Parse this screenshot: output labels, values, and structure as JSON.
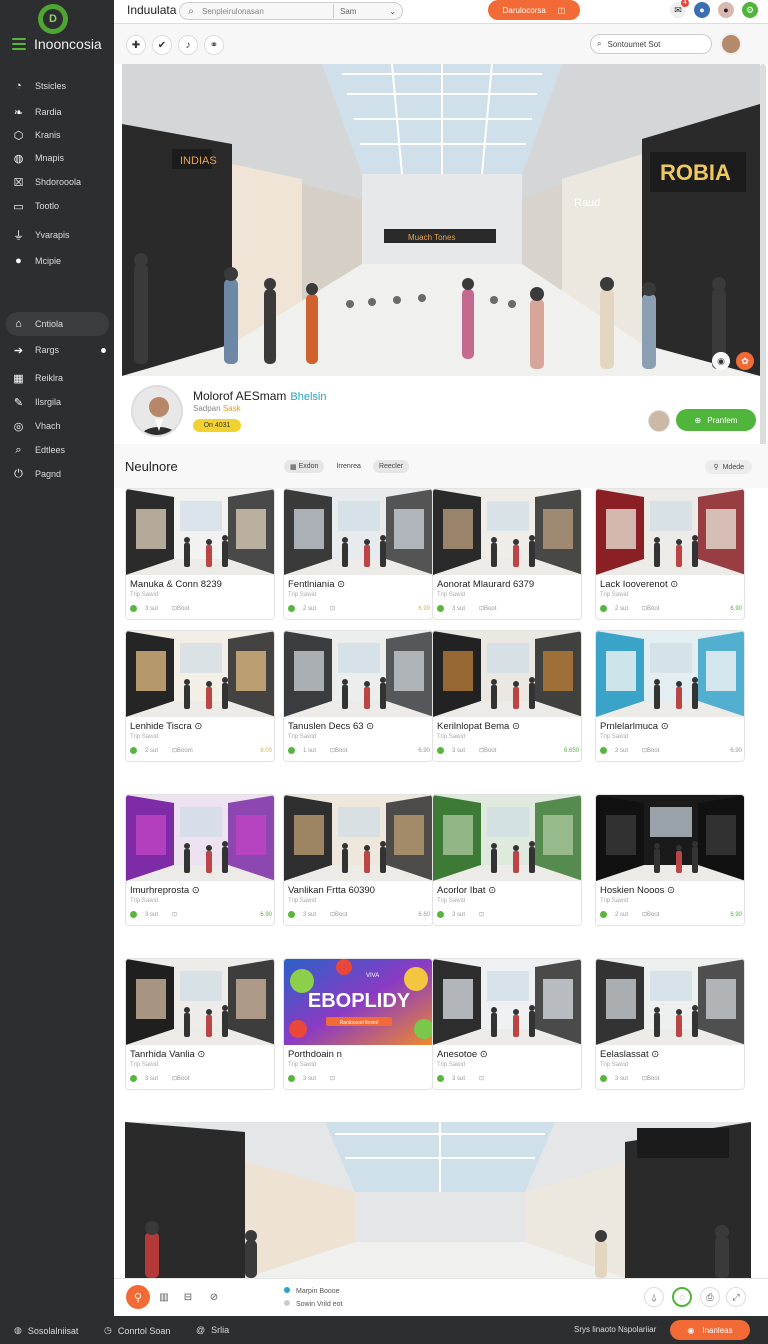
{
  "app": {
    "brand": "Inooncosia",
    "title": "Induulata"
  },
  "topbar": {
    "search_placeholder": "Senpleirulonasan",
    "select_value": "Sam",
    "cta_label": "Darulocorsa",
    "notif_count": "4"
  },
  "sidebar": {
    "items": [
      {
        "label": "Stsicles",
        "icon": "clock-icon"
      },
      {
        "label": "Rardia",
        "icon": "leaf-icon"
      },
      {
        "label": "Kranis",
        "icon": "tag-icon"
      },
      {
        "label": "Mnapis",
        "icon": "globe-icon"
      },
      {
        "label": "Shdorooola",
        "icon": "calendar-icon"
      },
      {
        "label": "Tootlo",
        "icon": "monitor-icon"
      },
      {
        "label": "Yvarapis",
        "icon": "signal-icon"
      },
      {
        "label": "Mcipie",
        "icon": "circle-icon"
      }
    ],
    "secondary": [
      {
        "label": "Cntiola",
        "icon": "grid-icon"
      },
      {
        "label": "Rargs",
        "icon": "arrow-icon"
      },
      {
        "label": "Reiklra",
        "icon": "apps-icon"
      },
      {
        "label": "Ilsrgila",
        "icon": "pen-icon"
      },
      {
        "label": "Vhach",
        "icon": "compass-icon"
      },
      {
        "label": "Edtlees",
        "icon": "search-icon"
      },
      {
        "label": "Pagnd",
        "icon": "power-icon"
      }
    ]
  },
  "hero": {
    "search_text": "Sontoumet Sot",
    "store_signs": [
      "INDIAS",
      "ROBIA",
      "Muach Tones",
      "Raud"
    ]
  },
  "profile": {
    "name": "Molorof AESmam",
    "tag": "Bhelsin",
    "subtitle": "Sadpan",
    "subtitle_accent": "Sask",
    "badge": "On 4031",
    "button_label": "Pranfem"
  },
  "section": {
    "title": "Neulnore",
    "tabs": [
      "Exdon",
      "Irrenrea",
      "Reecler"
    ],
    "filter_label": "Mdede"
  },
  "cards": [
    {
      "name": "Manuka & Conn 8239",
      "sub": "Trip Sawid",
      "m1": "3 sut",
      "m2": "Boot",
      "price": "",
      "pcolor": ""
    },
    {
      "name": "Fentlniania ⊙",
      "sub": "Trip Sawid",
      "m1": "2 sut",
      "m2": "",
      "price": "6.99",
      "pcolor": "y1"
    },
    {
      "name": "Aonorat Mlaurard 6379",
      "sub": "Trip Sawid",
      "m1": "3 sut",
      "m2": "Boot",
      "price": "",
      "pcolor": ""
    },
    {
      "name": "Lack Iooverenot ⊙",
      "sub": "Trip Sawid",
      "m1": "2 sut",
      "m2": "Boot",
      "price": "6.90",
      "pcolor": "g1"
    },
    {
      "name": "Lenhide Tiscra ⊙",
      "sub": "Trip Sawid",
      "m1": "2 sut",
      "m2": "Boom",
      "price": "8.00",
      "pcolor": "y1"
    },
    {
      "name": "Tanuslen Decs 63 ⊙",
      "sub": "Trip Sawid",
      "m1": "1 sut",
      "m2": "Boot",
      "price": "6.90",
      "pcolor": ""
    },
    {
      "name": "Kerilnlopat Bema ⊙",
      "sub": "Trip Sawid",
      "m1": "3 sut",
      "m2": "Boot",
      "price": "6.650",
      "pcolor": "g1"
    },
    {
      "name": "Prnlelarlmuca ⊙",
      "sub": "Trip Sawid",
      "m1": "2 sut",
      "m2": "Boot",
      "price": "6.90",
      "pcolor": ""
    },
    {
      "name": "Imurhreprosta ⊙",
      "sub": "Trip Sawid",
      "m1": "3 sut",
      "m2": "",
      "price": "6.90",
      "pcolor": "g1"
    },
    {
      "name": "Vanlikan Frtta 60390",
      "sub": "Trip Sawid",
      "m1": "3 sut",
      "m2": "Boot",
      "price": "6.60",
      "pcolor": ""
    },
    {
      "name": "Acorlor Ibat ⊙",
      "sub": "Trip Sawid",
      "m1": "3 sut",
      "m2": "",
      "price": "",
      "pcolor": ""
    },
    {
      "name": "Hoskien Nooos ⊙",
      "sub": "Trip Sawid",
      "m1": "2 sut",
      "m2": "Boot",
      "price": "6.90",
      "pcolor": "g1"
    },
    {
      "name": "Tanrhida Vanlia ⊙",
      "sub": "Trip Sawid",
      "m1": "3 sut",
      "m2": "Boot",
      "price": "",
      "pcolor": ""
    },
    {
      "name": "Porthdoain n",
      "sub": "Trip Sawid",
      "m1": "3 sut",
      "m2": "",
      "price": "",
      "pcolor": ""
    },
    {
      "name": "Anesotoe ⊙",
      "sub": "Trip Sawid",
      "m1": "3 sut",
      "m2": "",
      "price": "",
      "pcolor": ""
    },
    {
      "name": "Eelaslassat ⊙",
      "sub": "Trip Sawid",
      "m1": "3 sut",
      "m2": "Boot",
      "price": "",
      "pcolor": ""
    }
  ],
  "promo": {
    "small": "VIVA",
    "title": "EBOPLIDY",
    "subtitle": "Ranlorsoel fimrinl"
  },
  "bottom_bar": {
    "line1": "Marpin Boooe",
    "line2": "Sowin Vrild eot"
  },
  "status_bar": {
    "item1": "Sosolalniisat",
    "item2": "Conrtol Soan",
    "item3": "Srlia",
    "right_text": "Srys linaoto Nspolariiar",
    "button_label": "Inanleas"
  },
  "colors": {
    "accent": "#f26a35",
    "green": "#4fb53b",
    "sidebar": "#2c2e2f"
  }
}
